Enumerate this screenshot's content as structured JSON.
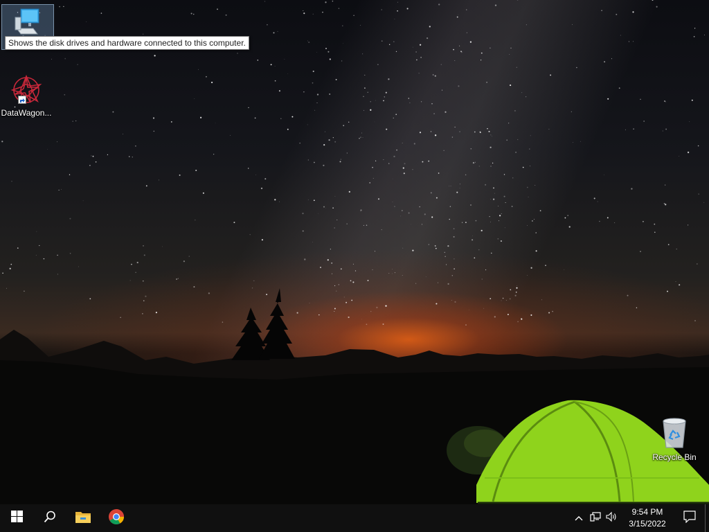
{
  "desktop": {
    "icons": [
      {
        "label": "This PC",
        "icon": "computer-icon"
      },
      {
        "label": "DataWagon...",
        "icon": "datawagon-icon"
      },
      {
        "label": "Recycle Bin",
        "icon": "recycle-bin-icon"
      }
    ],
    "tooltip": "Shows the disk drives and hardware connected to this computer."
  },
  "taskbar": {
    "start_icon": "windows-logo-icon",
    "search_icon": "search-icon",
    "pinned": [
      {
        "icon": "file-explorer-icon"
      },
      {
        "icon": "chrome-icon"
      }
    ],
    "tray": {
      "icons": [
        "chevron-up-icon",
        "network-icon",
        "volume-icon"
      ],
      "time": "9:54 PM",
      "date": "3/15/2022",
      "notification_icon": "action-center-icon"
    }
  },
  "colors": {
    "taskbar": "#101010",
    "tent": "#8fd31c",
    "sunset": "#e6601a"
  }
}
